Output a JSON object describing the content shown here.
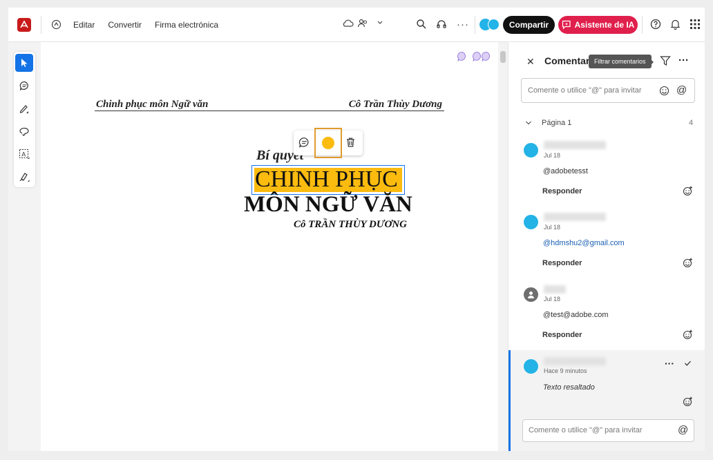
{
  "toolbar": {
    "edit": "Editar",
    "convert": "Convertir",
    "esign": "Firma electrónica",
    "share": "Compartir",
    "ai": "Asistente de IA"
  },
  "document": {
    "header_left": "Chinh phục môn Ngữ văn",
    "header_right": "Cô Trần Thùy Dương",
    "subtitle": "Bí quyết",
    "title1": "CHINH PHỤC",
    "title2": "MÔN NGỮ VĂN",
    "author": "Cô TRẦN THÙY DƯƠNG",
    "highlight_color": "#fbbb0f"
  },
  "comments": {
    "title": "Comentari",
    "tooltip": "Filtrar comentarios",
    "input_placeholder": "Comente o utilice \"@\" para invitar",
    "page_label": "Página 1",
    "page_count": "4",
    "items": [
      {
        "date": "Jul 18",
        "text": "@adobetesst",
        "reply": "Responder"
      },
      {
        "date": "Jul 18",
        "text": "@hdmshu2@gmail.com",
        "reply": "Responder"
      },
      {
        "date": "Jul 18",
        "text": "@test@adobe.com",
        "reply": "Responder"
      },
      {
        "date": "Hace 9 minutos",
        "text": "Texto resaltado"
      }
    ],
    "reply_placeholder": "Comente o utilice \"@\" para invitar"
  },
  "colors": {
    "accent": "#1473e6",
    "share_bg": "#111111",
    "ai_bg": "#e0204c",
    "highlight": "#fbbb0f",
    "selection_box": "#e09b2d"
  }
}
